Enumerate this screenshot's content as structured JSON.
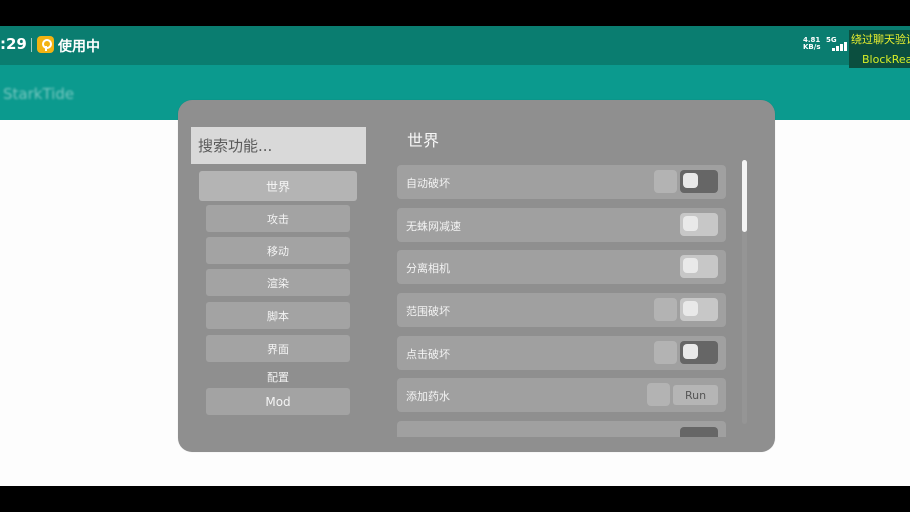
{
  "status_bar": {
    "time": ":29",
    "status_text": "使用中",
    "net_speed_value": "4.81",
    "net_speed_unit": "KB/s",
    "network_type": "5G"
  },
  "overlay": {
    "line1": "绕过聊天验证",
    "line2": "BlockRea"
  },
  "app": {
    "title": "StarkTide"
  },
  "menu": {
    "search_placeholder": "搜索功能...",
    "categories": [
      "世界",
      "攻击",
      "移动",
      "渲染",
      "脚本",
      "界面"
    ],
    "config_label": "配置",
    "mod_label": "Mod",
    "section_title": "世界",
    "settings": [
      {
        "label": "自动破坏",
        "control": "toggle",
        "state": "on"
      },
      {
        "label": "无蛛网减速",
        "control": "toggle",
        "state": "off"
      },
      {
        "label": "分离相机",
        "control": "toggle",
        "state": "off"
      },
      {
        "label": "范围破坏",
        "control": "toggle",
        "state": "off"
      },
      {
        "label": "点击破坏",
        "control": "toggle",
        "state": "on"
      },
      {
        "label": "添加药水",
        "control": "button",
        "button_label": "Run"
      }
    ]
  },
  "colors": {
    "status_bar": "#0a7d70",
    "app_bar": "#0b9a8e",
    "panel": "#8f8f8f",
    "toggle_on": "#666666",
    "toggle_off": "#c7c7c7"
  }
}
